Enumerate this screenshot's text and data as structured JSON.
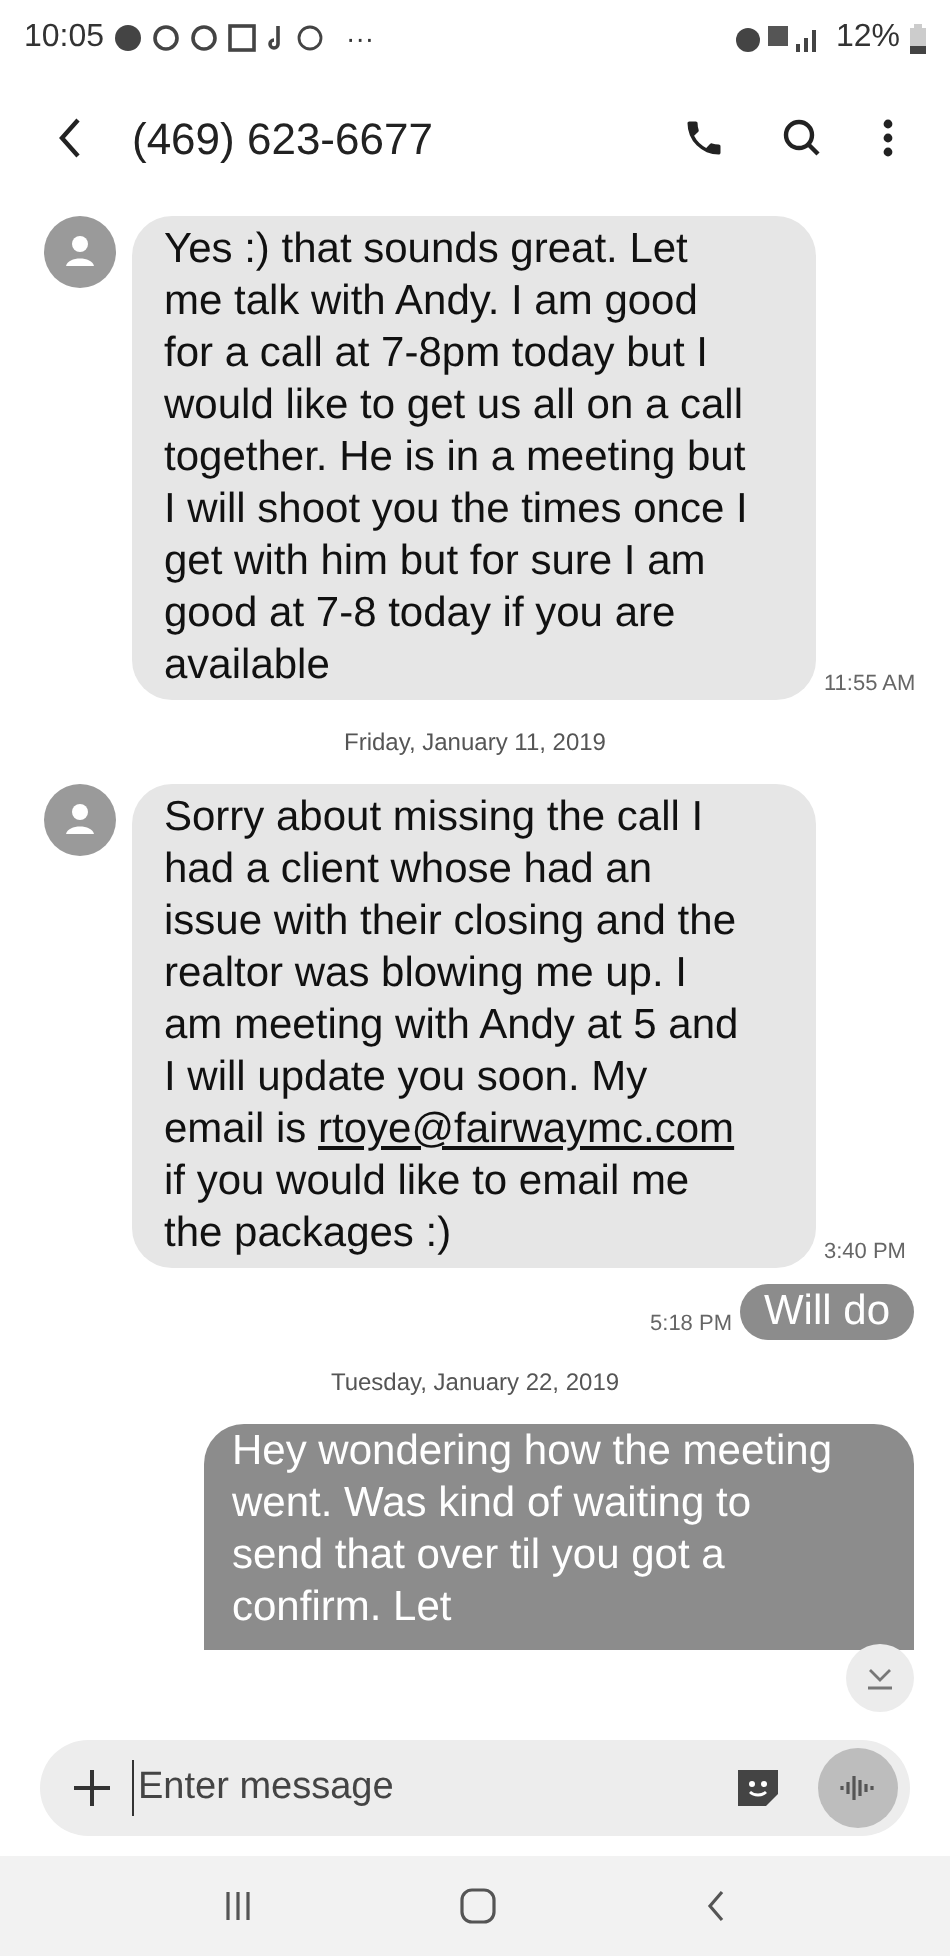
{
  "status_bar": {
    "time": "10:05",
    "more": "···",
    "battery": "12%"
  },
  "header": {
    "title": "(469) 623-6677"
  },
  "messages": [
    {
      "kind": "received",
      "parts": [
        {
          "text": "Yes :) that sounds great. Let me talk with Andy. I am good for a call at 7-8pm today but I would like to get us all on a call together. He is in a meeting but I will shoot you the times once I get with him but for sure I am good at 7-8 today if you are available"
        }
      ],
      "time": "11:55 AM"
    },
    {
      "kind": "date",
      "text": "Friday, January 11, 2019"
    },
    {
      "kind": "received",
      "parts": [
        {
          "text": "Sorry about missing the call I had a client whose had an issue with their closing and the realtor was blowing me up. I am meeting with Andy at 5 and I will update you soon. My email is "
        },
        {
          "kind": "link",
          "text": "rtoye@fairwaymc.com"
        },
        {
          "text": " if you would like to email me the packages :)"
        }
      ],
      "time": "3:40 PM"
    },
    {
      "kind": "sent",
      "parts": [
        {
          "text": "Will do"
        }
      ],
      "time": "5:18 PM"
    },
    {
      "kind": "date",
      "text": "Tuesday, January 22, 2019"
    },
    {
      "kind": "sent",
      "parts": [
        {
          "text": "Hey wondering how the meeting went. Was kind of waiting to send that over til you got a confirm. Let"
        }
      ]
    }
  ],
  "composer": {
    "placeholder": "Enter message"
  }
}
